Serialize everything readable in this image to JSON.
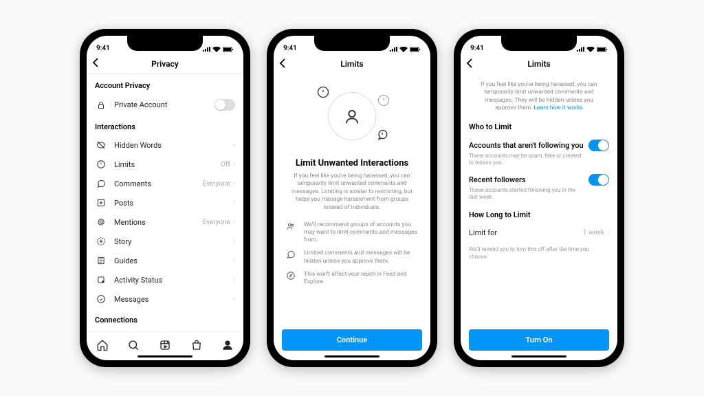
{
  "status_time": "9:41",
  "phone1": {
    "title": "Privacy",
    "section_account": "Account Privacy",
    "private_account": "Private Account",
    "section_interactions": "Interactions",
    "rows": [
      {
        "label": "Hidden Words",
        "value": ""
      },
      {
        "label": "Limits",
        "value": "Off"
      },
      {
        "label": "Comments",
        "value": "Everyone"
      },
      {
        "label": "Posts",
        "value": ""
      },
      {
        "label": "Mentions",
        "value": "Everyone"
      },
      {
        "label": "Story",
        "value": ""
      },
      {
        "label": "Guides",
        "value": ""
      },
      {
        "label": "Activity Status",
        "value": ""
      },
      {
        "label": "Messages",
        "value": ""
      }
    ],
    "section_connections": "Connections"
  },
  "phone2": {
    "title": "Limits",
    "headline": "Limit Unwanted Interactions",
    "desc": "If you feel like you're being harassed, you can temporarily limit unwanted comments and messages. Limiting is similar to restricting, but helps you manage harassment from groups instead of individuals.",
    "feat1": "We'll recommend groups of accounts you may want to limit comments and messages from.",
    "feat2": "Limited comments and messages will be hidden unless you approve them.",
    "feat3": "This won't affect your reach in Feed and Explore.",
    "button": "Continue"
  },
  "phone3": {
    "title": "Limits",
    "intro": "If you feel like you're being harassed, you can temporarily limit unwanted comments and messages. They will be hidden unless you approve them.",
    "learn": "Learn how it works",
    "section_who": "Who to Limit",
    "opt1_title": "Accounts that aren't following you",
    "opt1_sub": "These accounts may be spam, fake or created to harass you.",
    "opt2_title": "Recent followers",
    "opt2_sub": "These accounts started following you in the last week.",
    "section_how": "How Long to Limit",
    "limit_for_label": "Limit for",
    "limit_for_value": "1 week",
    "hint": "We'll remind you to turn this off after the time you choose.",
    "button": "Turn On"
  }
}
